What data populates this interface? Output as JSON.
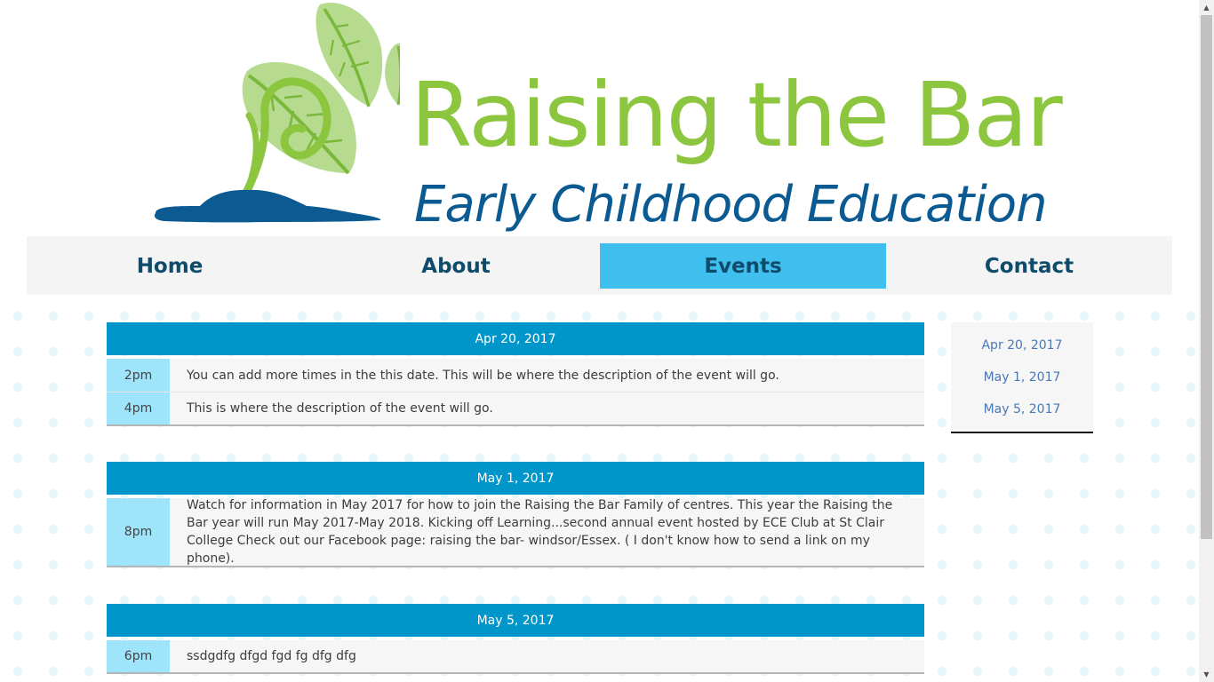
{
  "brand": {
    "title": "Raising the Bar",
    "subtitle": "Early Childhood Education"
  },
  "nav": {
    "items": [
      {
        "label": "Home",
        "active": false
      },
      {
        "label": "About",
        "active": false
      },
      {
        "label": "Events",
        "active": true
      },
      {
        "label": "Contact",
        "active": false
      }
    ]
  },
  "events": [
    {
      "date": "Apr 20, 2017",
      "items": [
        {
          "time": "2pm",
          "description": "You can add more times in the this date. This will be where the description of the event will go."
        },
        {
          "time": "4pm",
          "description": "This is where the description of the event will go."
        }
      ]
    },
    {
      "date": "May 1, 2017",
      "items": [
        {
          "time": "8pm",
          "description": "Watch for information in May 2017 for how to join the Raising the Bar Family of centres. This year the Raising the Bar year will run May 2017-May 2018. Kicking off Learning...second annual event hosted by ECE Club at St Clair College Check out our Facebook page: raising the bar- windsor/Essex. ( I don't know how to send a link on my phone)."
        }
      ]
    },
    {
      "date": "May 5, 2017",
      "items": [
        {
          "time": "6pm",
          "description": "ssdgdfg dfgd fgd fg dfg dfg"
        }
      ]
    }
  ],
  "sidebar": {
    "dates": [
      "Apr 20, 2017",
      "May 1, 2017",
      "May 5, 2017"
    ]
  },
  "colors": {
    "brand_green": "#8cc63f",
    "brand_blue": "#0b5a92",
    "nav_active": "#3fbfed",
    "date_bar": "#0096ca",
    "time_cell": "#9ee4fb",
    "sidebar_link": "#4a78b5"
  }
}
